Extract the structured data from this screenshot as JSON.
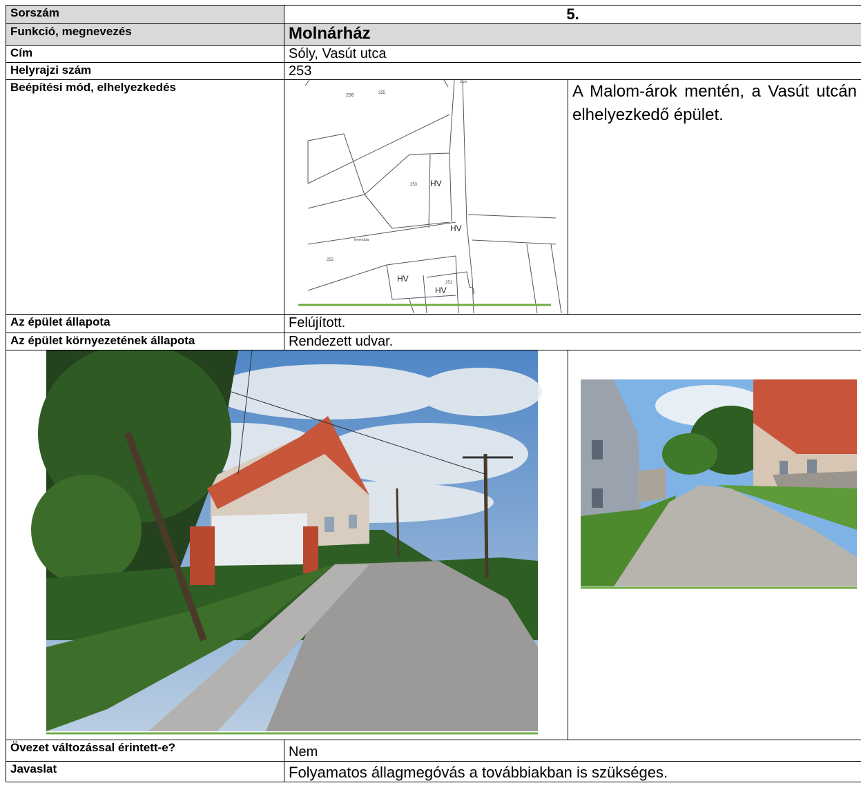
{
  "record": {
    "number_label": "Sorszám",
    "number_value": "5.",
    "function_label": "Funkció, megnevezés",
    "function_value": "Molnárház",
    "address_label": "Cím",
    "address_value": "Sóly, Vasút utca",
    "parcel_label": "Helyrajzi szám",
    "parcel_value": "253",
    "placement_label": "Beépítési mód, elhelyezkedés",
    "placement_description": "A Malom-árok mentén, a Vasút utcán elhelyezkedő épület.",
    "condition_label": "Az épület állapota",
    "condition_value": "Felújított.",
    "surroundings_label": "Az épület környezetének állapota",
    "surroundings_value": "Rendezett udvar.",
    "zone_change_label": "Övezet változással érintett-e?",
    "zone_change_value": "Nem",
    "proposal_label": "Javaslat",
    "proposal_value": "Folyamatos állagmegóvás a továbbiakban is szükséges."
  },
  "map": {
    "labels": [
      "256",
      "255",
      "255",
      "253",
      "HV",
      "HV",
      "252",
      "HV",
      "251",
      "HV",
      "levendula"
    ]
  },
  "colors": {
    "shade": "#d9d9d9",
    "accent_line": "#70ad47"
  }
}
